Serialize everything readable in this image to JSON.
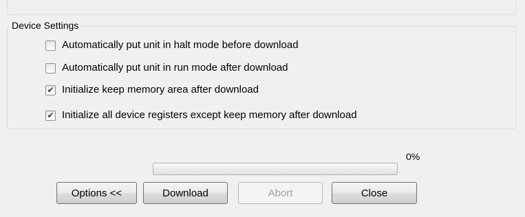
{
  "device_settings": {
    "title": "Device Settings",
    "options": [
      {
        "label": "Automatically put unit in halt mode before download",
        "checked": false
      },
      {
        "label": "Automatically put unit in run mode after download",
        "checked": false
      },
      {
        "label": "Initialize keep memory area after download",
        "checked": true
      },
      {
        "label": "Initialize all device registers except keep memory after download",
        "checked": true
      }
    ]
  },
  "progress": {
    "value": 0,
    "label": "0%",
    "fill_color": "#06b025"
  },
  "buttons": {
    "options": "Options <<",
    "download": "Download",
    "abort": "Abort",
    "close": "Close"
  }
}
